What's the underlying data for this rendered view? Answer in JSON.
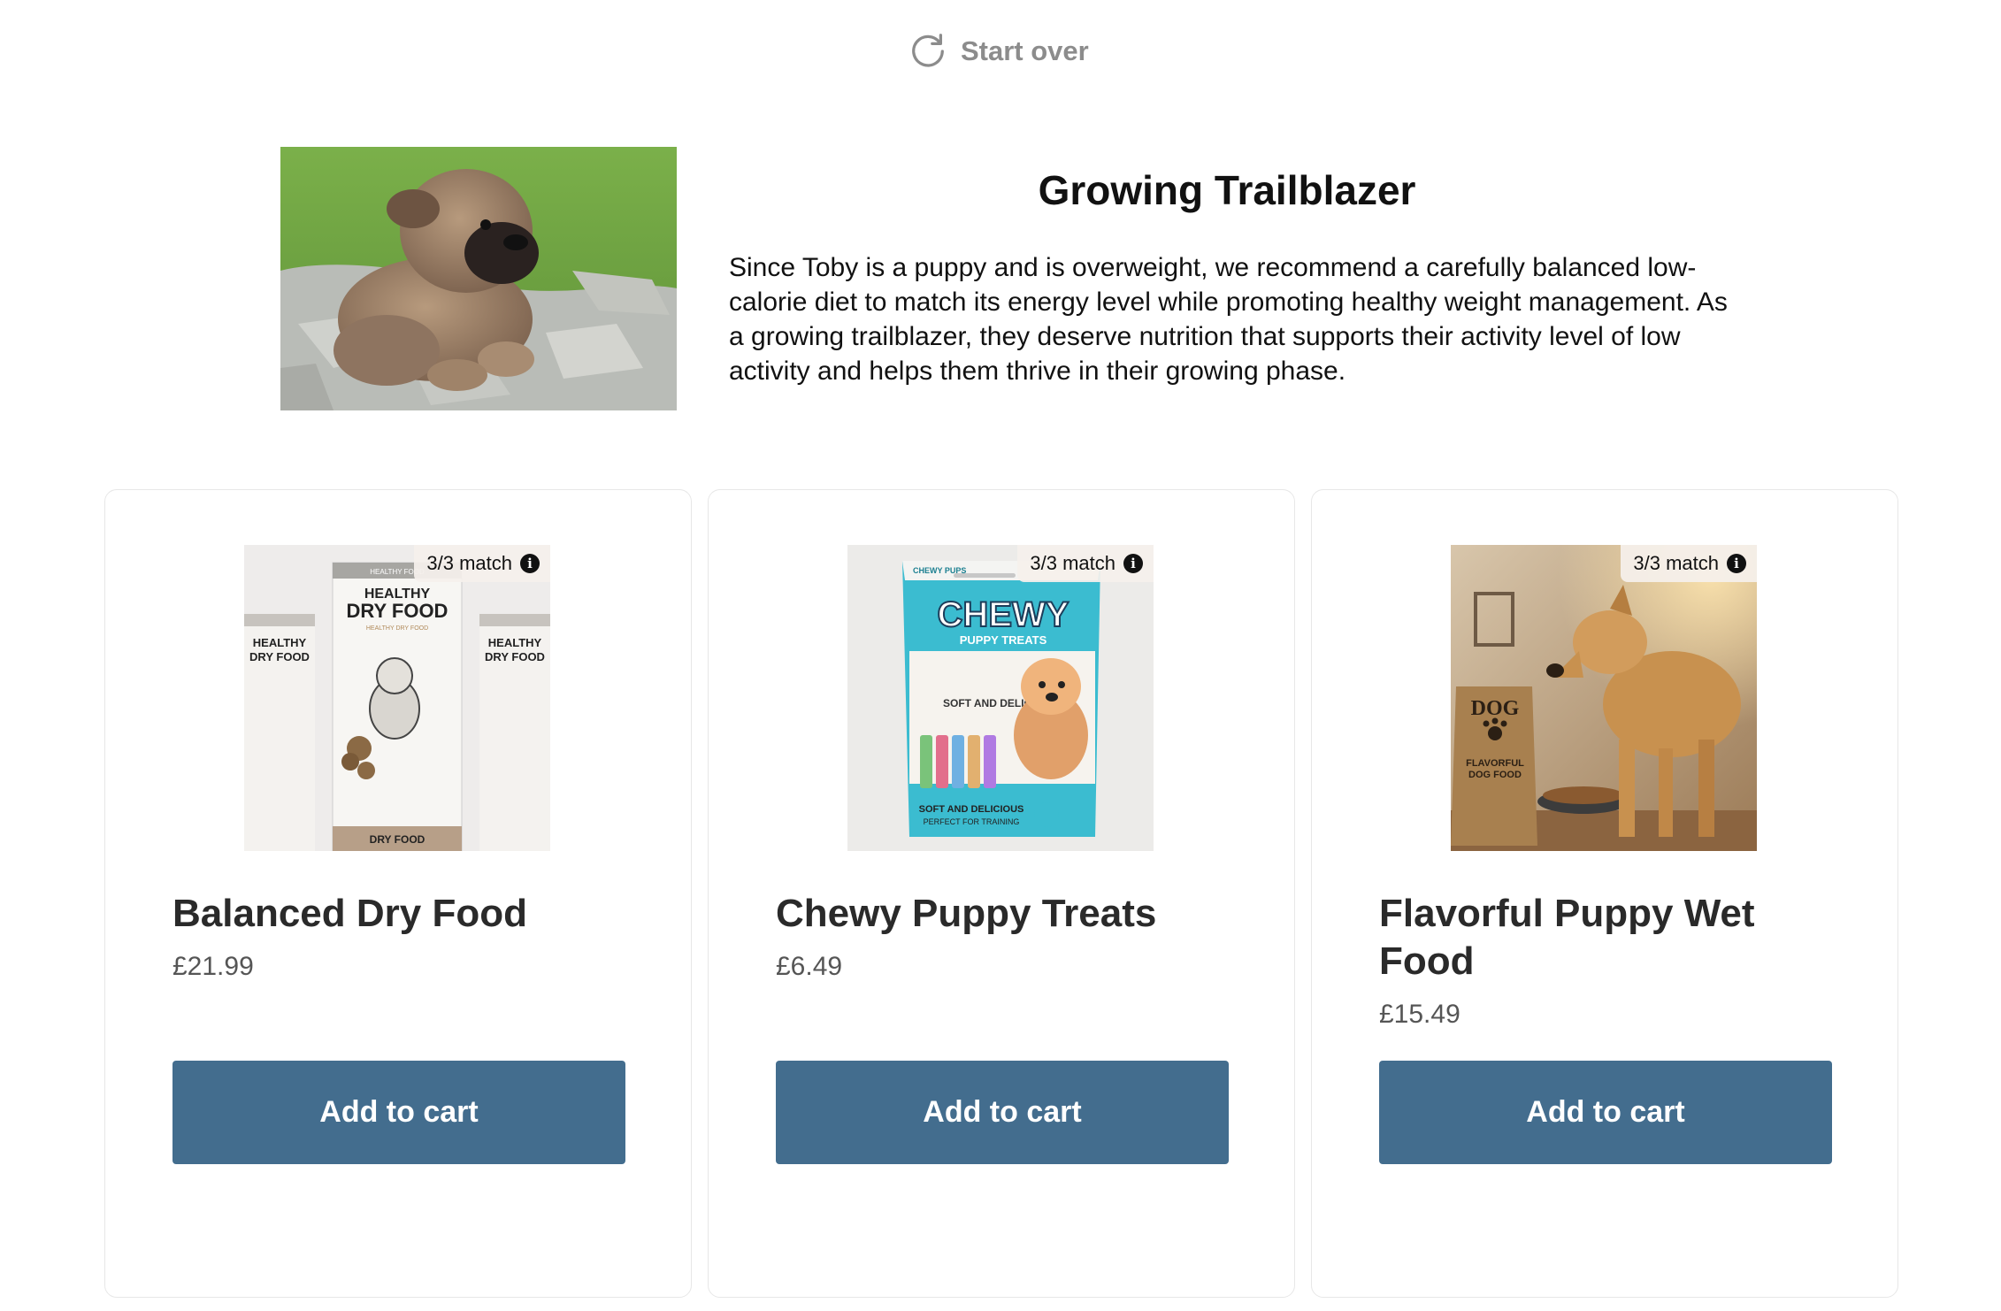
{
  "header": {
    "start_over_label": "Start over",
    "start_over_icon": "refresh-icon"
  },
  "hero": {
    "title": "Growing Trailblazer",
    "description": "Since Toby is a puppy and is overweight, we recommend a carefully balanced low-calorie diet to match its energy level while promoting healthy weight management. As a growing trailblazer, they deserve nutrition that supports their activity level of low activity and helps them thrive in their growing phase.",
    "photo_icon": "puppy-photo"
  },
  "products": [
    {
      "name": "Balanced Dry Food",
      "price": "£21.99",
      "match": "3/3 match",
      "button_label": "Add to cart",
      "image": {
        "main_brand": "HEALTHY",
        "main_product": "DRY FOOD",
        "top_tag": "HEALTHY FOOD",
        "sub": "HEALTHY DRY FOOD",
        "side_brand": "HEALTHY",
        "side_product": "DRY FOOD",
        "footer": "DRY FOOD"
      }
    },
    {
      "name": "Chewy Puppy Treats",
      "price": "£6.49",
      "match": "3/3 match",
      "button_label": "Add to cart",
      "image": {
        "corner": "CHEWY PUPS",
        "brand": "CHEWY",
        "sub": "PUPPY TREATS",
        "tag": "SOFT AND DELICIOUS",
        "footer_1": "SOFT AND DELICIOUS",
        "footer_2": "PERFECT FOR TRAINING"
      }
    },
    {
      "name": "Flavorful Puppy Wet Food",
      "price": "£15.49",
      "match": "3/3 match",
      "button_label": "Add to cart",
      "image": {
        "bag_brand": "DOG",
        "bag_sub_1": "FLAVORFUL",
        "bag_sub_2": "DOG FOOD"
      }
    }
  ],
  "colors": {
    "button": "#436d8e",
    "muted": "#8c8c8c",
    "card_border": "#e7e7e7"
  }
}
